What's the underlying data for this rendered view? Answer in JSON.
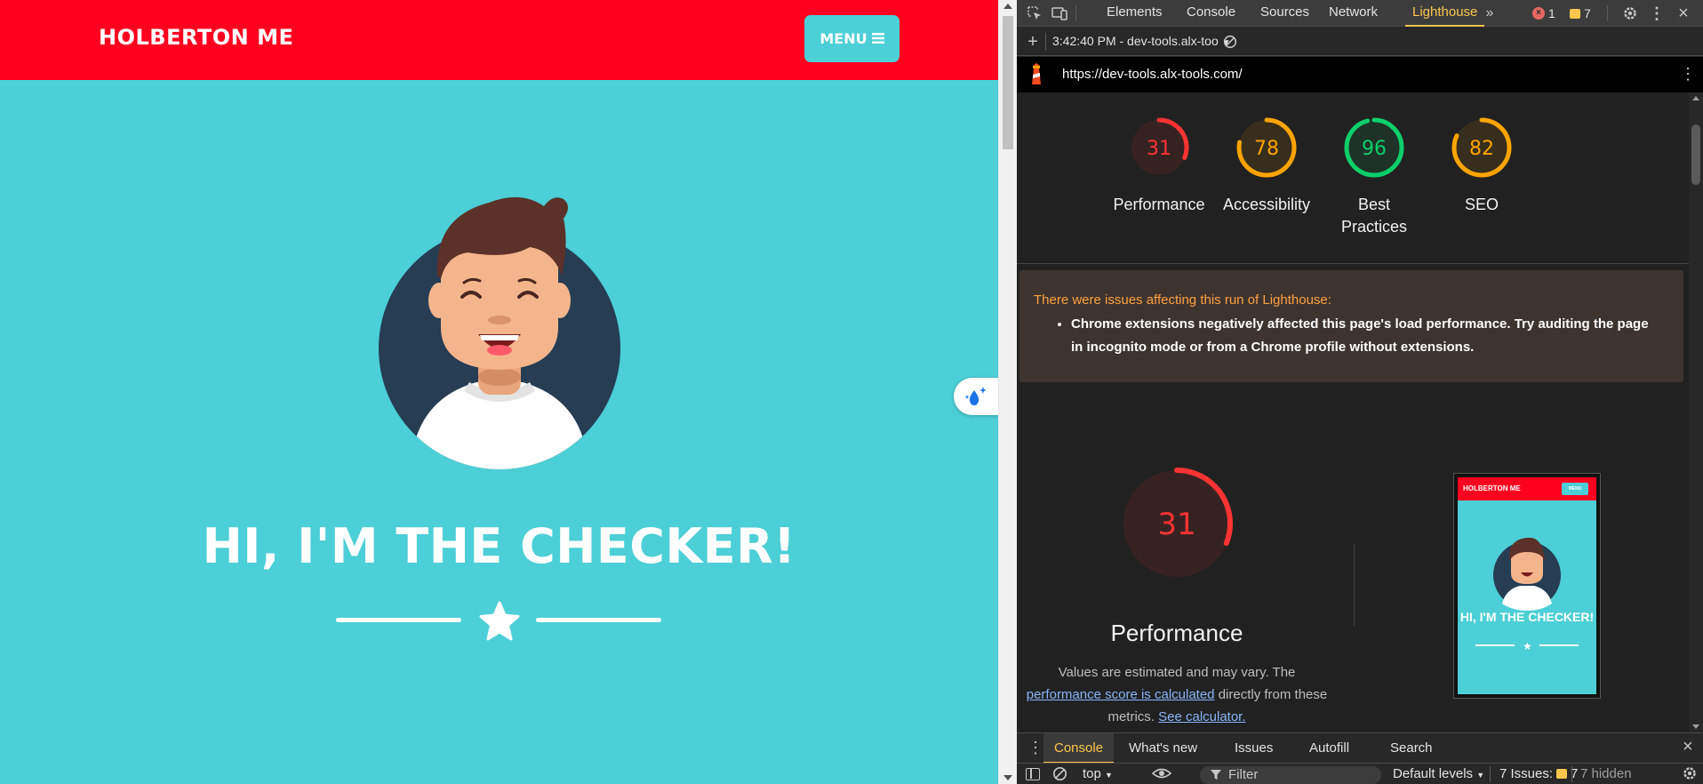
{
  "page": {
    "brand": "HOLBERTON ME",
    "menu_label": "MENU",
    "hero_title": "HI, I'M THE CHECKER!",
    "colors": {
      "navbar": "#ff0020",
      "background": "#4ccfd6",
      "text": "#ffffff"
    }
  },
  "devtools": {
    "tabs": [
      "Elements",
      "Console",
      "Sources",
      "Network",
      "Lighthouse"
    ],
    "active_tab": "Lighthouse",
    "error_count": "1",
    "issue_count": "7",
    "report_select": "3:42:40 PM - dev-tools.alx-too",
    "url": "https://dev-tools.alx-tools.com/",
    "gauges": [
      {
        "score": "31",
        "label": "Performance",
        "value": 31,
        "color": "#ff3333"
      },
      {
        "score": "78",
        "label": "Accessibility",
        "value": 78,
        "color": "#ffa400"
      },
      {
        "score": "96",
        "label": "Best Practices",
        "value": 96,
        "color": "#0cce6b"
      },
      {
        "score": "82",
        "label": "SEO",
        "value": 82,
        "color": "#ffa400"
      }
    ],
    "warning": {
      "title": "There were issues affecting this run of Lighthouse:",
      "item": "Chrome extensions negatively affected this page's load performance. Try auditing the page in incognito mode or from a Chrome profile without extensions."
    },
    "perf": {
      "score": "31",
      "value": 31,
      "title": "Performance",
      "desc_prefix": "Values are estimated and may vary. The",
      "link1": "performance score is calculated",
      "desc_mid": "directly from these metrics.",
      "link2": "See calculator."
    },
    "thumbnail": {
      "brand": "HOLBERTON ME",
      "menu": "MENU",
      "title": "HI, I'M THE CHECKER!"
    },
    "drawer_tabs": [
      "Console",
      "What's new",
      "Issues",
      "Autofill",
      "Search"
    ],
    "active_drawer_tab": "Console",
    "console_bar": {
      "context": "top",
      "filter_placeholder": "Filter",
      "levels": "Default levels",
      "issues_label": "7 Issues:",
      "issues_count": "7",
      "hidden": "7 hidden"
    }
  }
}
